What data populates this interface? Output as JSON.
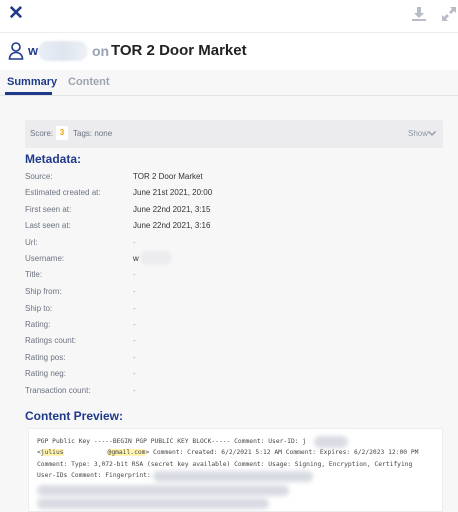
{
  "header": {
    "close_icon": "close-icon",
    "download_icon": "download-icon",
    "expand_icon": "expand-icon",
    "user_initial": "w",
    "on_word": "on",
    "market_name": "TOR 2 Door Market"
  },
  "tabs": [
    {
      "label": "Summary",
      "active": true
    },
    {
      "label": "Content",
      "active": false
    }
  ],
  "scorebar": {
    "score_label": "Score:",
    "score_value": "3",
    "tags_label": "Tags: none",
    "show_label": "Show"
  },
  "metadata": {
    "title": "Metadata:",
    "rows": [
      {
        "label": "Source:",
        "value": "TOR 2 Door Market"
      },
      {
        "label": "Estimated created at:",
        "value": "June 21st 2021, 20:00"
      },
      {
        "label": "First seen at:",
        "value": "June 22nd 2021, 3:15"
      },
      {
        "label": "Last seen at:",
        "value": "June 22nd 2021, 3:16"
      },
      {
        "label": "Url:",
        "value": "-"
      },
      {
        "label": "Username:",
        "value": "w"
      },
      {
        "label": "Title:",
        "value": "-"
      },
      {
        "label": "Ship from:",
        "value": "-"
      },
      {
        "label": "Ship to:",
        "value": "-"
      },
      {
        "label": "Rating:",
        "value": "-"
      },
      {
        "label": "Ratings count:",
        "value": "-"
      },
      {
        "label": "Rating pos:",
        "value": "-"
      },
      {
        "label": "Rating neg:",
        "value": "-"
      },
      {
        "label": "Transaction count:",
        "value": "-"
      }
    ]
  },
  "preview": {
    "title": "Content Preview:",
    "line1": "PGP Public Key -----BEGIN PGP PUBLIC KEY BLOCK----- Comment: User-ID: j",
    "line2_open": "<",
    "line2_hl1": "julius",
    "line2_hl2": "@gmail.com",
    "line2_rest": "> Comment: Created: 6/2/2021 5:12 AM Comment: Expires: 6/2/2023 12:00 PM",
    "line3": "Comment: Type: 3,072-bit RSA (secret key available) Comment: Usage: Signing, Encryption, Certifying",
    "line4": "User-IDs Comment: Fingerprint:"
  }
}
